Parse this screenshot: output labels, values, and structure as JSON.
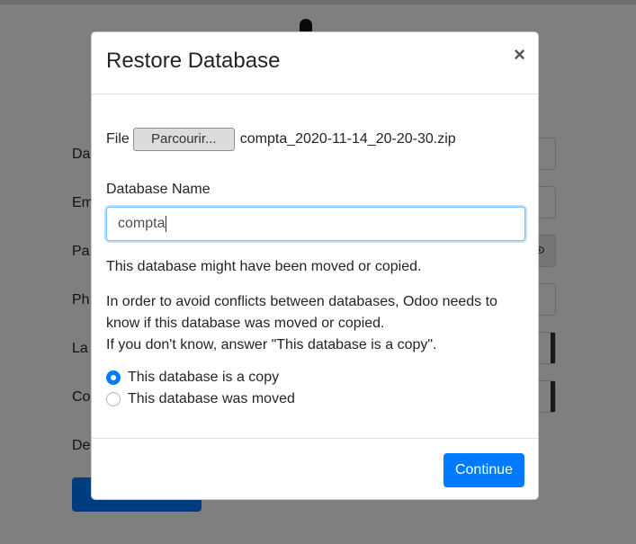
{
  "modal": {
    "title": "Restore Database",
    "close_glyph": "×",
    "file_label": "File",
    "browse_label": "Parcourir...",
    "file_name": "compta_2020-11-14_20-20-30.zip",
    "db_name_label": "Database Name",
    "db_name_value": "compta",
    "moved_message": "This database might have been moved or copied.",
    "explanation_line1": "In order to avoid conflicts between databases, Odoo needs to know if this database was moved or copied.",
    "explanation_line2": "If you don't know, answer \"This database is a copy\".",
    "options": [
      {
        "label": "This database is a copy",
        "checked": true
      },
      {
        "label": "This database was moved",
        "checked": false
      }
    ],
    "continue_label": "Continue"
  },
  "background": {
    "labels": [
      "Da",
      "Em",
      "Pa",
      "Ph",
      "La",
      "Co",
      "De"
    ],
    "eye_icon": "eye-icon",
    "accent": "#007bff"
  }
}
